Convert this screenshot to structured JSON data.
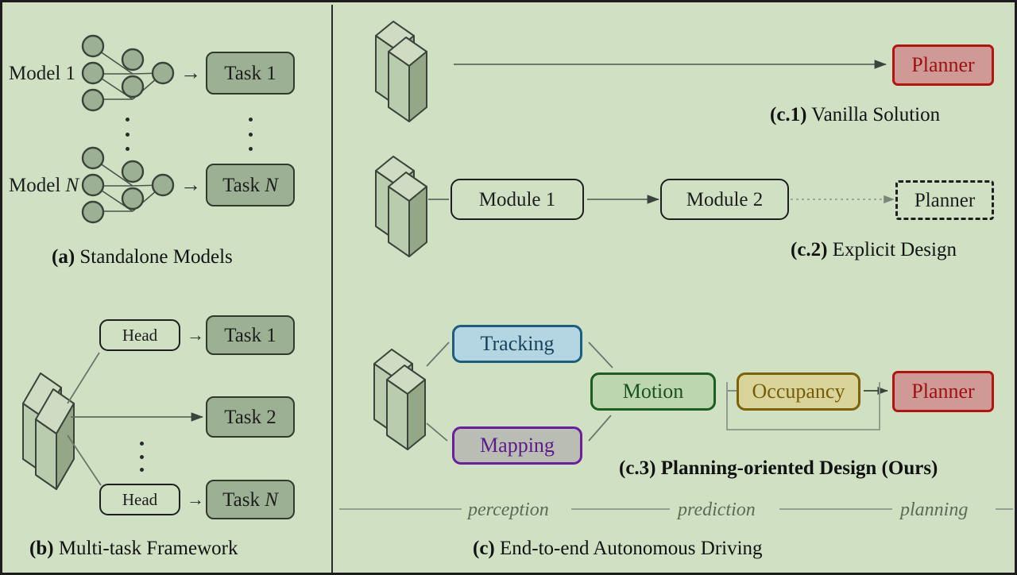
{
  "figure": {
    "background_color": "#cfe0c3",
    "border_color": "#1d1d1d"
  },
  "panel_a": {
    "caption_prefix": "(a)",
    "caption_text": " Standalone Models",
    "models": [
      {
        "label_prefix": "Model ",
        "label_suffix": "1",
        "task_label": "Task 1"
      },
      {
        "label_prefix": "Model ",
        "label_suffix": "N",
        "task_label": "Task N"
      }
    ],
    "arrow_glyph": "→",
    "network": {
      "input_nodes": 3,
      "hidden_nodes": 2,
      "output_nodes": 1,
      "node_fill": "#9cb094",
      "node_stroke": "#303a2e"
    }
  },
  "panel_b": {
    "caption_prefix": "(b)",
    "caption_text": " Multi-task Framework",
    "backbone_icon": "stacked-slabs-icon",
    "branches": [
      {
        "head_label": "Head",
        "task_label": "Task 1"
      },
      {
        "head_label": "",
        "task_label": "Task 2"
      },
      {
        "head_label": "Head",
        "task_label": "Task N"
      }
    ],
    "arrow_glyph": "→"
  },
  "panel_c": {
    "caption_prefix": "(c)",
    "caption_text": " End-to-end Autonomous Driving",
    "stages": [
      "perception",
      "prediction",
      "planning"
    ],
    "c1": {
      "caption_prefix": "(c.1)",
      "caption_text": " Vanilla Solution",
      "planner_label": "Planner",
      "planner_fill": "#cf9a95",
      "planner_border": "#b21414"
    },
    "c2": {
      "caption_prefix": "(c.2)",
      "caption_text": " Explicit Design",
      "module1_label": "Module 1",
      "module2_label": "Module 2",
      "planner_label": "Planner",
      "planner_style": "dashed"
    },
    "c3": {
      "caption_prefix": "(c.3)",
      "caption_text": " Planning-oriented Design (Ours)",
      "tracking_label": "Tracking",
      "mapping_label": "Mapping",
      "motion_label": "Motion",
      "occupancy_label": "Occupancy",
      "planner_label": "Planner",
      "colors": {
        "tracking_fill": "#b4d5e2",
        "tracking_border": "#1d5d7e",
        "mapping_fill": "#b9bdb4",
        "mapping_border": "#6a1f9c",
        "motion_fill": "#bcd7b0",
        "motion_border": "#1e5c20",
        "occupancy_fill": "#d9d59a",
        "occupancy_border": "#7d6208",
        "planner_fill": "#cf9a95",
        "planner_border": "#b21414"
      }
    }
  }
}
